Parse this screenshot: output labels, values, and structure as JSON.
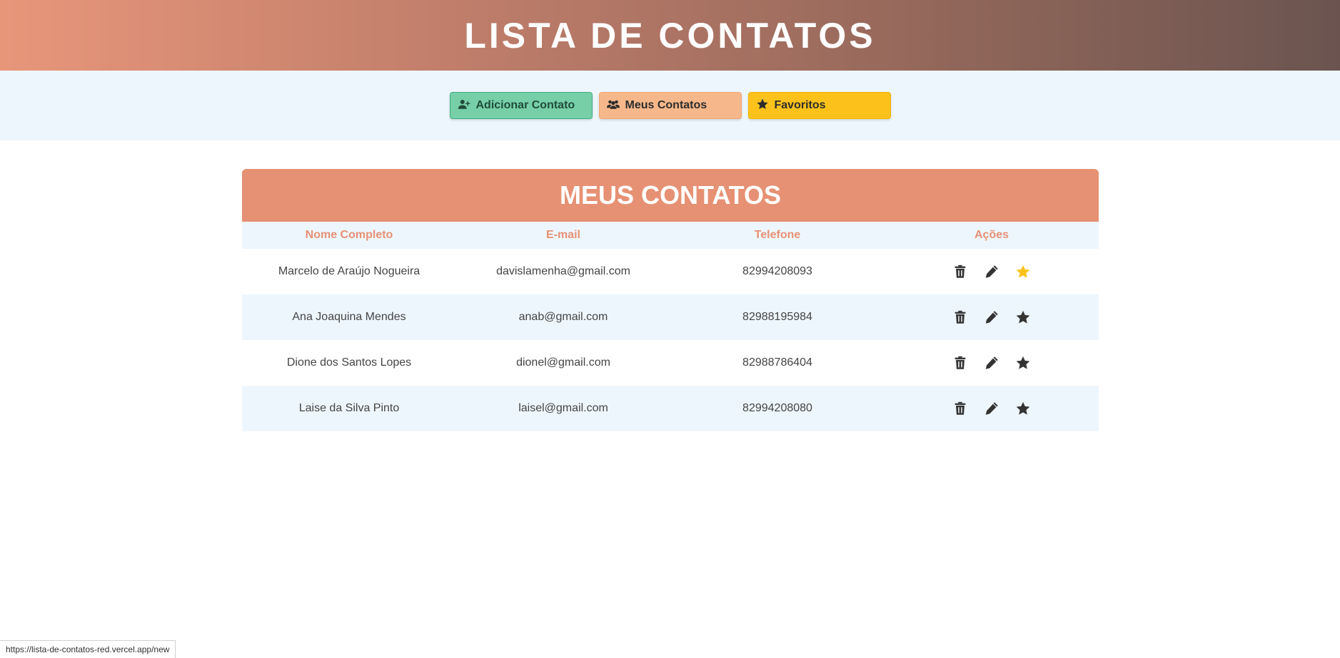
{
  "app": {
    "title": "LISTA DE CONTATOS"
  },
  "nav": {
    "add_label": "Adicionar Contato",
    "mine_label": "Meus Contatos",
    "fav_label": "Favoritos"
  },
  "panel": {
    "title": "MEUS CONTATOS"
  },
  "table": {
    "headers": [
      "Nome Completo",
      "E-mail",
      "Telefone",
      "Ações"
    ],
    "rows": [
      {
        "name": "Marcelo de Araújo Nogueira",
        "email": "davislamenha@gmail.com",
        "phone": "82994208093",
        "favorite": true
      },
      {
        "name": "Ana Joaquina Mendes",
        "email": "anab@gmail.com",
        "phone": "82988195984",
        "favorite": false
      },
      {
        "name": "Dione dos Santos Lopes",
        "email": "dionel@gmail.com",
        "phone": "82988786404",
        "favorite": false
      },
      {
        "name": "Laise da Silva Pinto",
        "email": "laisel@gmail.com",
        "phone": "82994208080",
        "favorite": false
      }
    ]
  },
  "icons": {
    "delete": "trash-icon",
    "edit": "pencil-icon",
    "favorite": "star-icon"
  },
  "colors": {
    "accent": "#e69174",
    "favorite_active": "#fcc21b",
    "icon_default": "#333333"
  },
  "status_bar": {
    "url": "https://lista-de-contatos-red.vercel.app/new"
  }
}
